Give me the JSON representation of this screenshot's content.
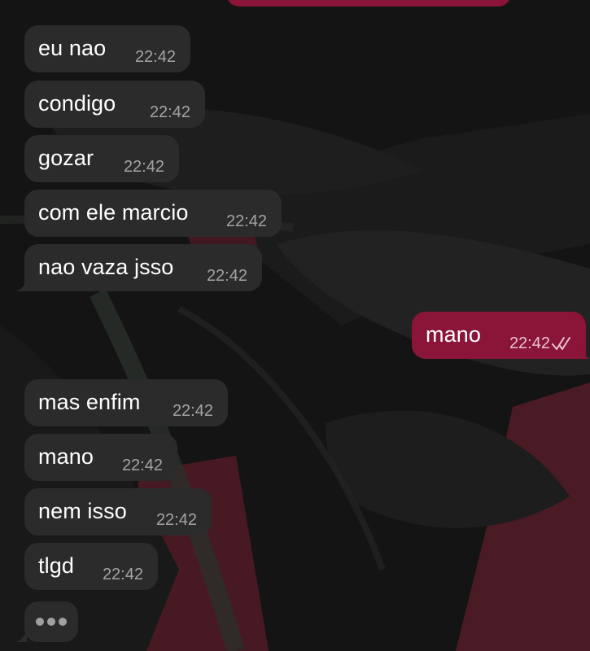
{
  "colors": {
    "incoming_bubble": "#2b2b2b",
    "outgoing_bubble": "#8a1538",
    "timestamp_incoming": "#a4a4a4",
    "timestamp_outgoing": "#e8c3cf"
  },
  "messages": [
    {
      "text": "eu nao",
      "time": "22:42",
      "direction": "incoming"
    },
    {
      "text": "condigo",
      "time": "22:42",
      "direction": "incoming"
    },
    {
      "text": "gozar",
      "time": "22:42",
      "direction": "incoming"
    },
    {
      "text": "com ele marcio",
      "time": "22:42",
      "direction": "incoming"
    },
    {
      "text": "nao vaza jsso",
      "time": "22:42",
      "direction": "incoming"
    },
    {
      "text": "mano",
      "time": "22:42",
      "direction": "outgoing",
      "status_icon": "double-check-icon"
    },
    {
      "text": "mas enfim",
      "time": "22:42",
      "direction": "incoming"
    },
    {
      "text": "mano",
      "time": "22:42",
      "direction": "incoming"
    },
    {
      "text": "nem isso",
      "time": "22:42",
      "direction": "incoming"
    },
    {
      "text": "tlgd",
      "time": "22:42",
      "direction": "incoming"
    }
  ],
  "typing_indicator": {
    "icon": "typing-dots-icon"
  }
}
